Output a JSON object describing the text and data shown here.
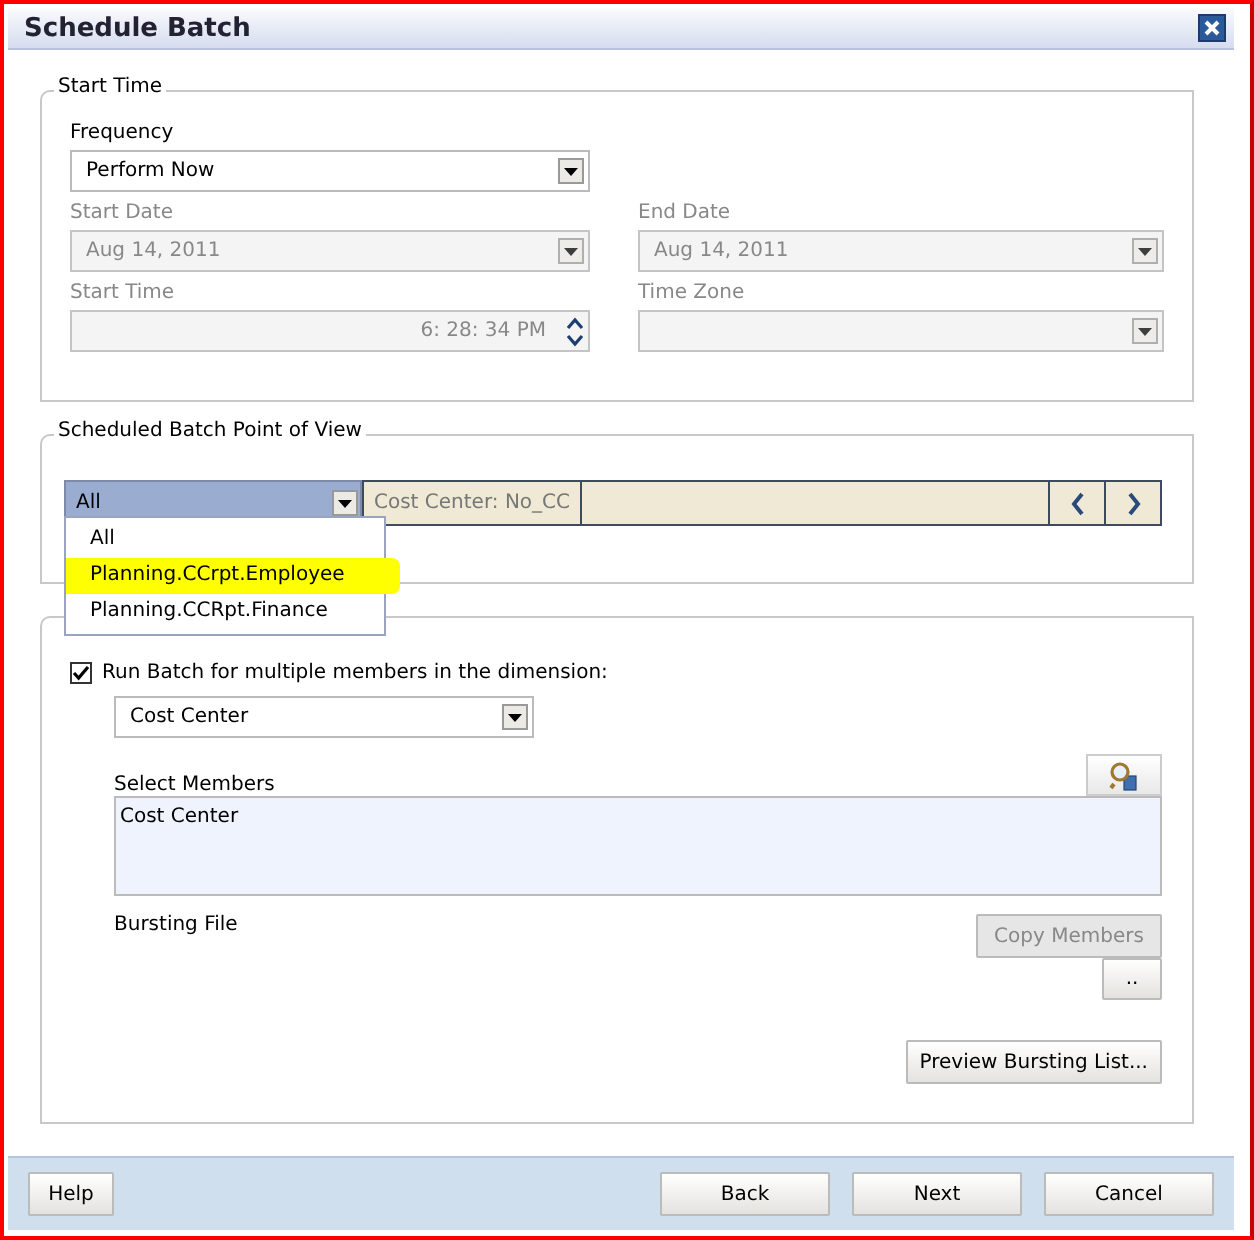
{
  "window": {
    "title": "Schedule Batch"
  },
  "start_time": {
    "legend": "Start Time",
    "rows": [
      [
        {
          "label": "Frequency",
          "value": "Perform Now",
          "kind": "select",
          "disabled": false
        }
      ],
      [
        {
          "label": "Start Date",
          "value": "Aug 14, 2011",
          "kind": "select",
          "disabled": true
        },
        {
          "label": "End Date",
          "value": "Aug 14, 2011",
          "kind": "select",
          "disabled": true
        }
      ],
      [
        {
          "label": "Start Time",
          "value": "6: 28: 34 PM",
          "kind": "spinner",
          "disabled": true
        },
        {
          "label": "Time Zone",
          "kind": "select",
          "disabled": true
        }
      ]
    ]
  },
  "point_of_view": {
    "legend": "Scheduled Batch Point of View",
    "selector": {
      "value": "All",
      "expanded": true
    },
    "member": "Cost Center: No_CC",
    "options": [
      {
        "label": "All",
        "highlighted": false
      },
      {
        "label": "Planning.CCrpt.Employee",
        "highlighted": true
      },
      {
        "label": "Planning.CCRpt.Finance",
        "highlighted": false
      }
    ]
  },
  "bursting": {
    "run_multiple": {
      "label": "Run Batch for multiple members in the dimension:",
      "checked": true
    },
    "dimension": "Cost Center",
    "select_members_label": "Select Members",
    "members": "Cost Center",
    "bursting_file_label": "Bursting File",
    "copy_members": {
      "label": "Copy Members",
      "disabled": true
    },
    "browse": "..",
    "preview": "Preview Bursting List..."
  },
  "help_button": "Help",
  "buttons": [
    "Back",
    "Next",
    "Cancel"
  ]
}
